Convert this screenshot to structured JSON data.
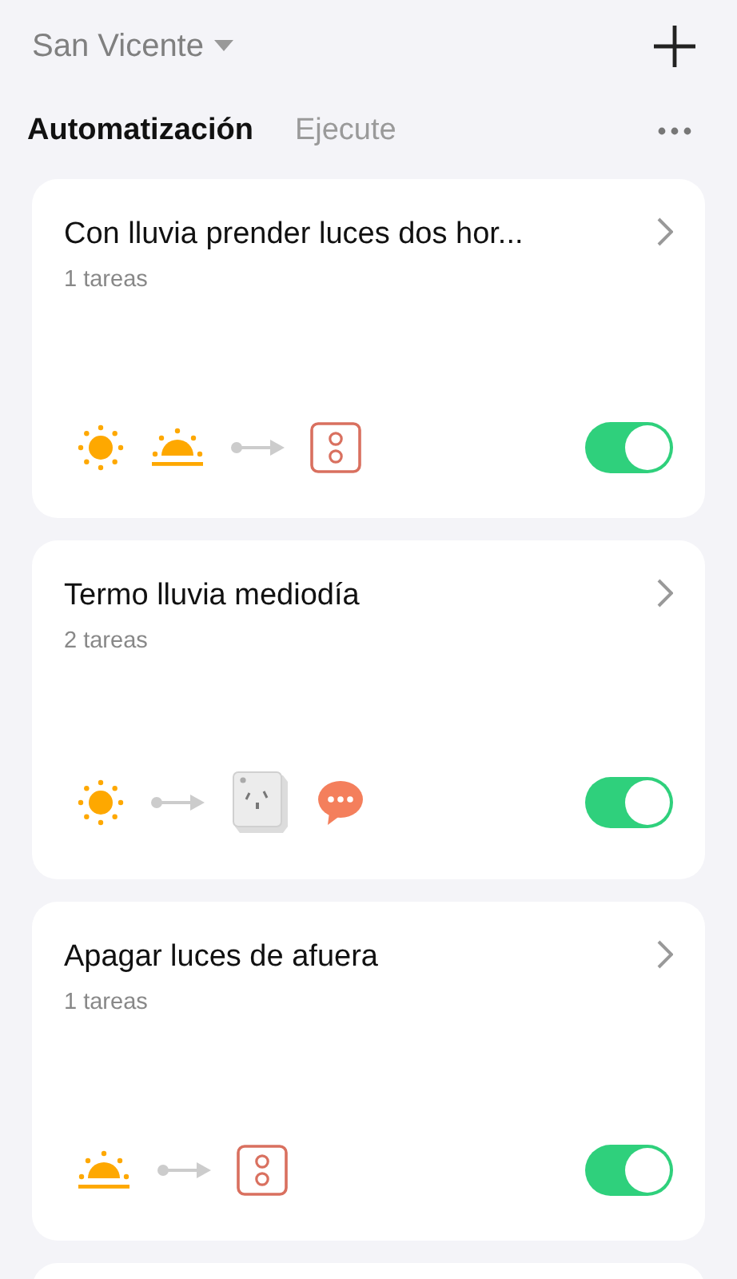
{
  "header": {
    "location": "San Vicente"
  },
  "tabs": [
    {
      "label": "Automatización",
      "selected": true
    },
    {
      "label": "Ejecute",
      "selected": false
    }
  ],
  "automations": [
    {
      "title": "Con lluvia prender luces dos hor...",
      "subtitle": "1 tareas",
      "on": true,
      "icons": [
        {
          "kind": "sun"
        },
        {
          "kind": "sunset"
        },
        {
          "kind": "arrow"
        },
        {
          "kind": "switch"
        }
      ]
    },
    {
      "title": "Termo lluvia mediodía",
      "subtitle": "2 tareas",
      "on": true,
      "icons": [
        {
          "kind": "sun"
        },
        {
          "kind": "arrow"
        },
        {
          "kind": "plug"
        },
        {
          "kind": "message"
        }
      ]
    },
    {
      "title": "Apagar luces de afuera",
      "subtitle": "1 tareas",
      "on": true,
      "icons": [
        {
          "kind": "sunset"
        },
        {
          "kind": "arrow"
        },
        {
          "kind": "switch"
        }
      ]
    }
  ]
}
